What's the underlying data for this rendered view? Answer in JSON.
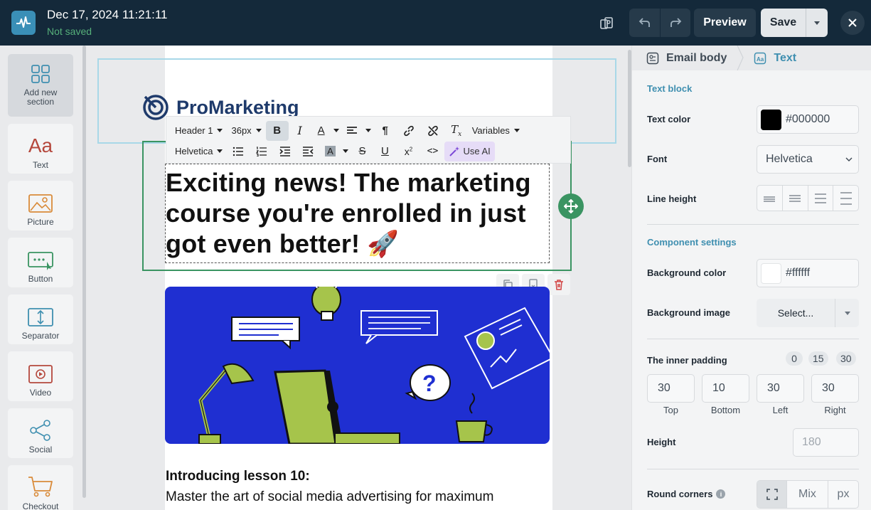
{
  "topbar": {
    "title": "Dec 17, 2024 11:21:11",
    "status": "Not saved",
    "preview_label": "Preview",
    "save_label": "Save"
  },
  "sidebar": {
    "items": [
      {
        "label": "Add new section",
        "icon": "grid-icon"
      },
      {
        "label": "Text",
        "icon": "text-icon"
      },
      {
        "label": "Picture",
        "icon": "picture-icon"
      },
      {
        "label": "Button",
        "icon": "button-icon"
      },
      {
        "label": "Separator",
        "icon": "separator-icon"
      },
      {
        "label": "Video",
        "icon": "video-icon"
      },
      {
        "label": "Social",
        "icon": "share-icon"
      },
      {
        "label": "Checkout",
        "icon": "cart-icon"
      }
    ]
  },
  "email": {
    "brand": "ProMarketing",
    "headline": "Exciting news! The marketing course you're enrolled in just got even better! 🚀",
    "intro_title": "Introducing lesson 10:",
    "intro_text": "Master the art of social media advertising for maximum"
  },
  "toolbar": {
    "block_type": "Header 1",
    "font_size": "36px",
    "variables": "Variables",
    "font": "Helvetica",
    "ai_label": "Use AI"
  },
  "panel": {
    "crumb_body": "Email body",
    "crumb_text": "Text",
    "section_text_block": "Text block",
    "text_color_label": "Text color",
    "text_color_value": "#000000",
    "font_label": "Font",
    "font_value": "Helvetica",
    "line_height_label": "Line height",
    "section_component": "Component settings",
    "bg_color_label": "Background color",
    "bg_color_value": "#ffffff",
    "bg_image_label": "Background image",
    "bg_image_value": "Select...",
    "padding_label": "The inner padding",
    "padding_presets": [
      "0",
      "15",
      "30"
    ],
    "padding": {
      "top": "30",
      "bottom": "10",
      "left": "30",
      "right": "30"
    },
    "padding_labels": {
      "top": "Top",
      "bottom": "Bottom",
      "left": "Left",
      "right": "Right"
    },
    "height_label": "Height",
    "height_placeholder": "180",
    "round_label": "Round corners",
    "round_mix": "Mix",
    "round_unit": "px"
  },
  "colors": {
    "topbar": "#14293a",
    "accent": "#3f8fb0",
    "selected_border": "#3a9462",
    "illustration_bg": "#1f2fd1"
  }
}
